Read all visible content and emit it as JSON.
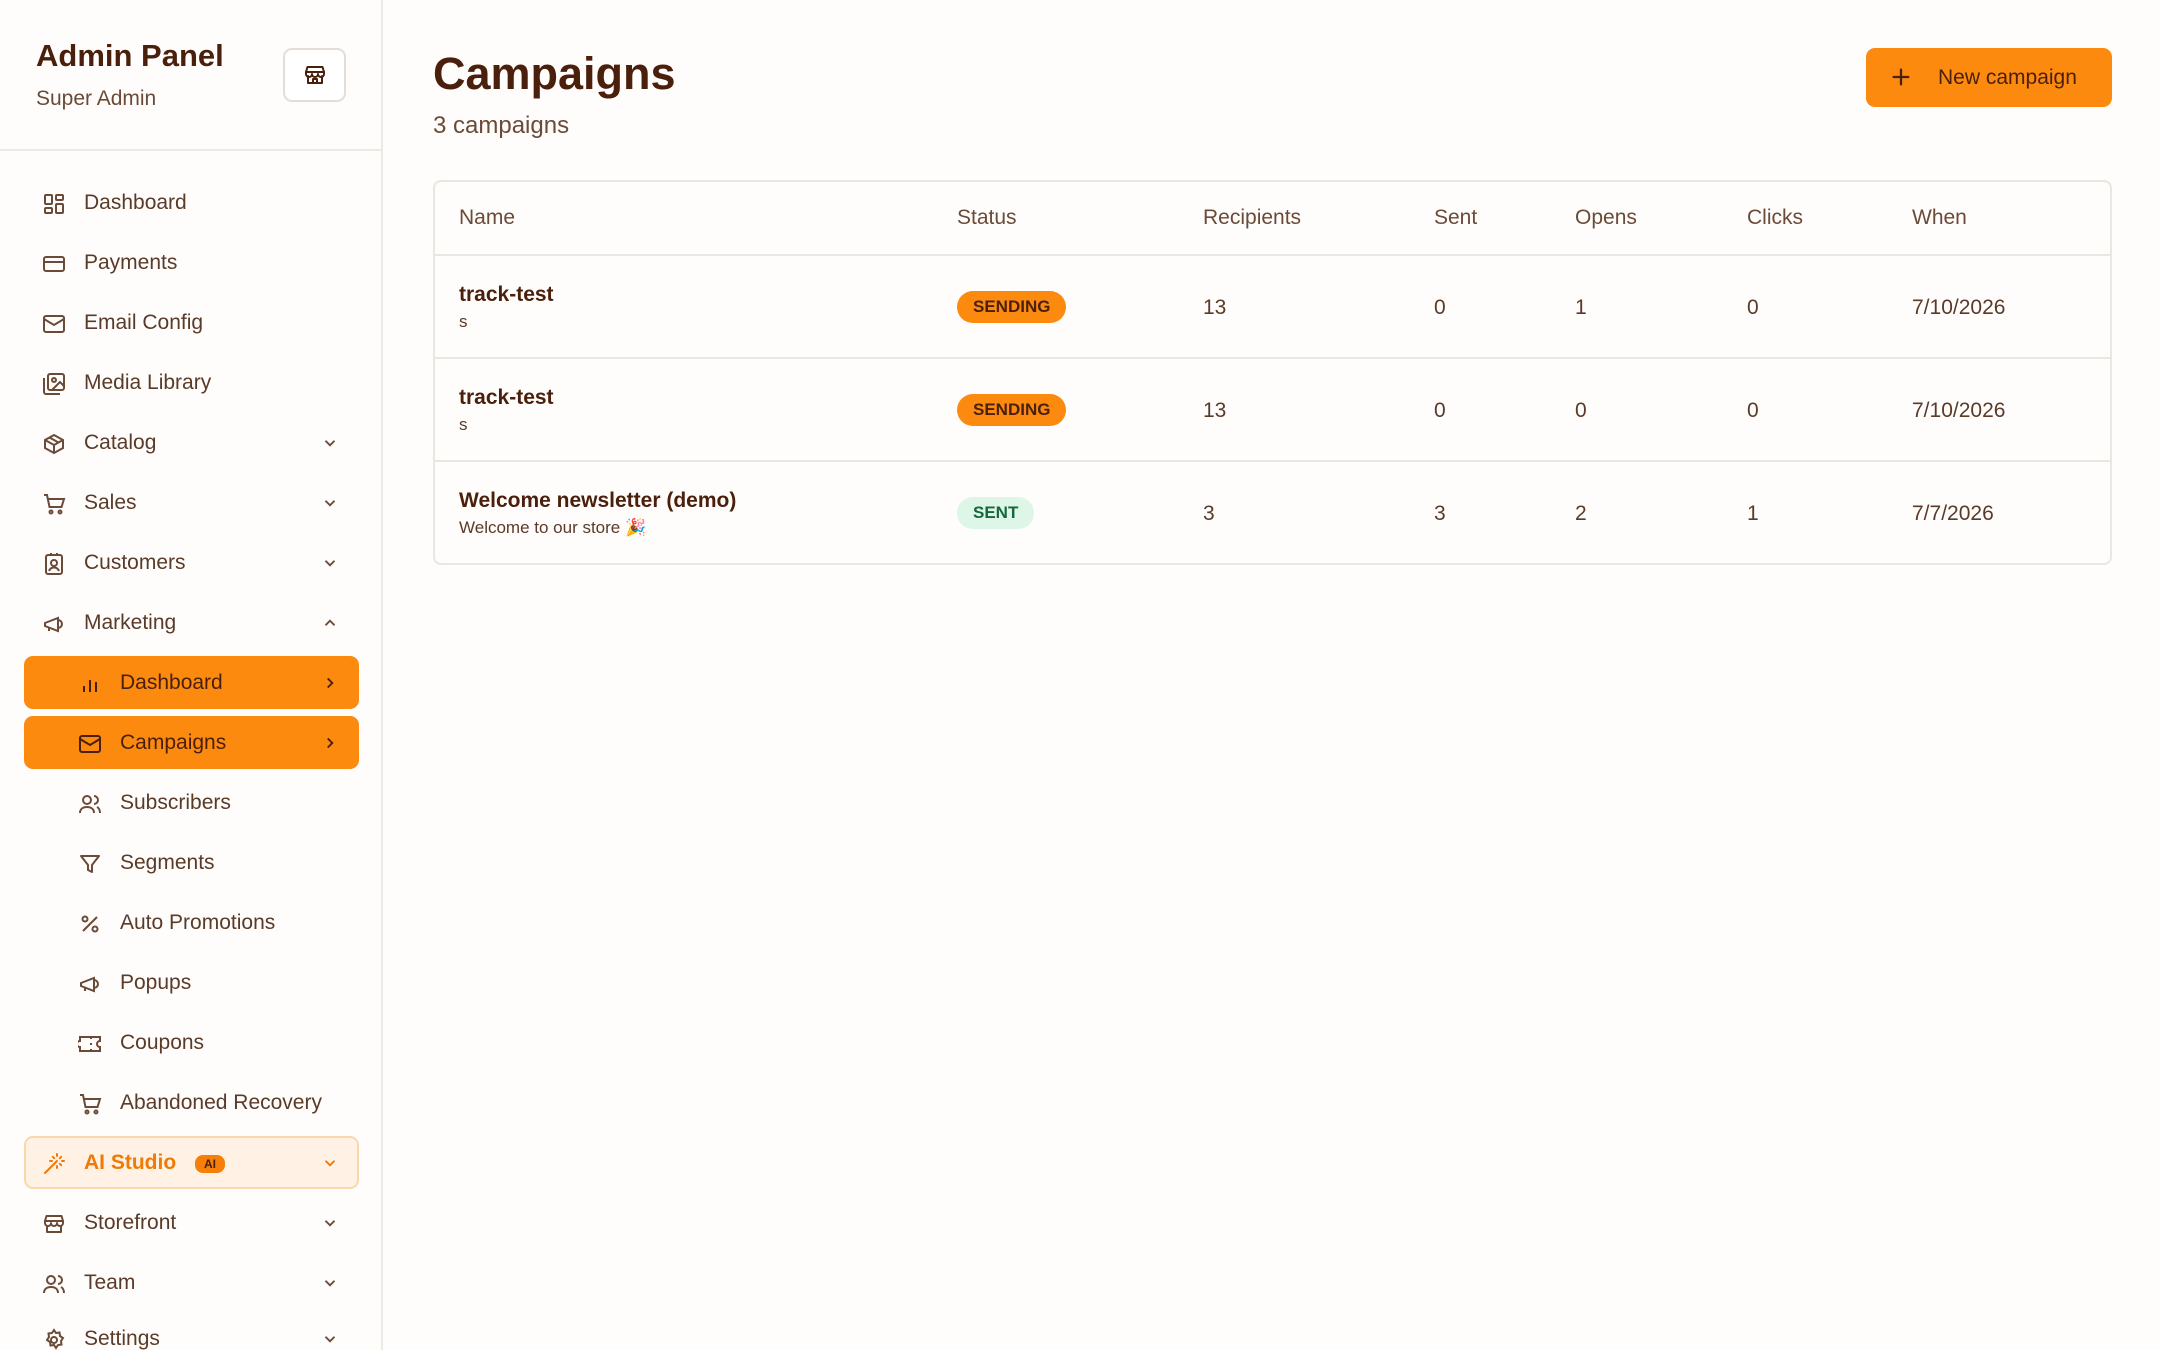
{
  "sidebar": {
    "title": "Admin Panel",
    "subtitle": "Super Admin",
    "items": [
      {
        "label": "Dashboard"
      },
      {
        "label": "Payments"
      },
      {
        "label": "Email Config"
      },
      {
        "label": "Media Library"
      },
      {
        "label": "Catalog"
      },
      {
        "label": "Sales"
      },
      {
        "label": "Customers"
      },
      {
        "label": "Marketing"
      },
      {
        "label": "Dashboard"
      },
      {
        "label": "Campaigns"
      },
      {
        "label": "Subscribers"
      },
      {
        "label": "Segments"
      },
      {
        "label": "Auto Promotions"
      },
      {
        "label": "Popups"
      },
      {
        "label": "Coupons"
      },
      {
        "label": "Abandoned Recovery"
      },
      {
        "label": "AI Studio",
        "badge": "AI"
      },
      {
        "label": "Storefront"
      },
      {
        "label": "Team"
      },
      {
        "label": "Settings"
      }
    ]
  },
  "main": {
    "title": "Campaigns",
    "subtitle": "3 campaigns",
    "new_button": "New campaign",
    "table": {
      "headers": [
        "Name",
        "Status",
        "Recipients",
        "Sent",
        "Opens",
        "Clicks",
        "When"
      ],
      "rows": [
        {
          "name": "track-test",
          "subject": "s",
          "status": "SENDING",
          "recipients": "13",
          "sent": "0",
          "opens": "1",
          "clicks": "0",
          "when": "7/10/2026"
        },
        {
          "name": "track-test",
          "subject": "s",
          "status": "SENDING",
          "recipients": "13",
          "sent": "0",
          "opens": "0",
          "clicks": "0",
          "when": "7/10/2026"
        },
        {
          "name": "Welcome newsletter (demo)",
          "subject": "Welcome to our store 🎉",
          "status": "SENT",
          "recipients": "3",
          "sent": "3",
          "opens": "2",
          "clicks": "1",
          "when": "7/7/2026"
        }
      ]
    }
  },
  "colors": {
    "accent": "#fb8a0e",
    "text_dark": "#4a1f0b",
    "sent_bg": "#ddf6e7",
    "sent_text": "#16683a"
  }
}
